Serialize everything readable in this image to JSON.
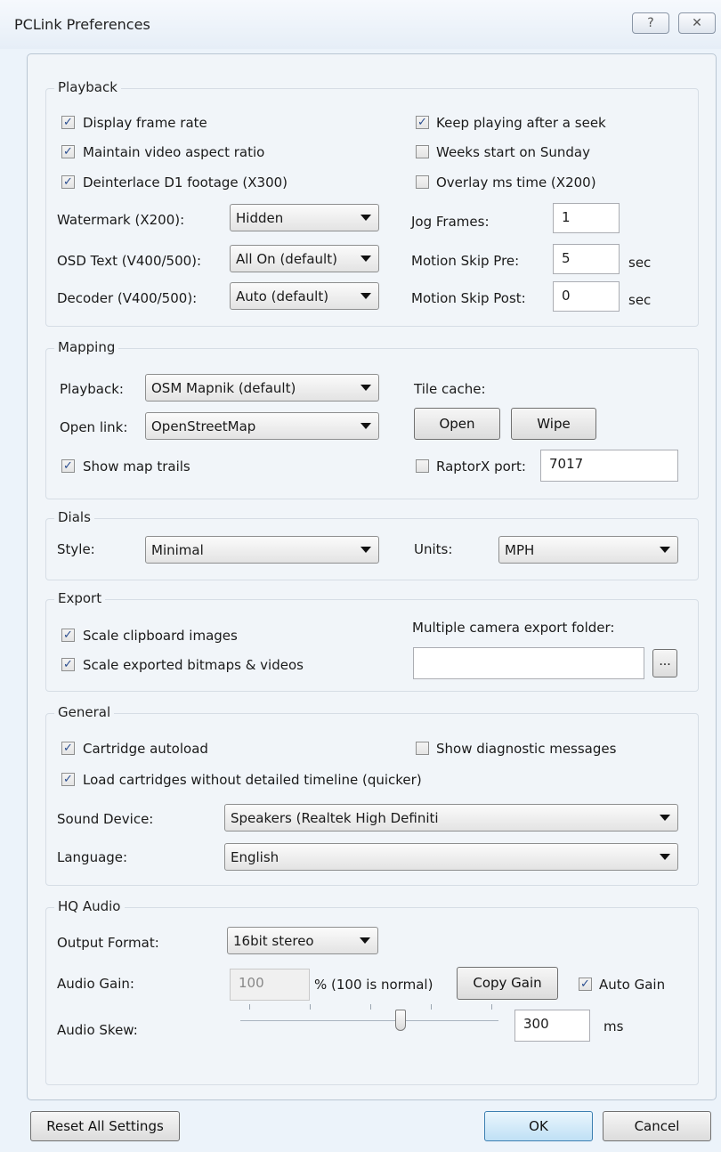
{
  "window": {
    "title": "PCLink Preferences",
    "help_label": "?",
    "close_label": "☒"
  },
  "playback": {
    "title": "Playback",
    "display_frame_rate": {
      "label": "Display frame rate",
      "checked": true
    },
    "maintain_aspect": {
      "label": "Maintain video aspect ratio",
      "checked": true
    },
    "deinterlace": {
      "label": "Deinterlace D1 footage (X300)",
      "checked": true
    },
    "keep_playing": {
      "label": "Keep playing after a seek",
      "checked": true
    },
    "weeks_sunday": {
      "label": "Weeks start on Sunday",
      "checked": false
    },
    "overlay_ms": {
      "label": "Overlay ms time (X200)",
      "checked": false
    },
    "watermark": {
      "label": "Watermark (X200):",
      "value": "Hidden"
    },
    "osd_text": {
      "label": "OSD Text (V400/500):",
      "value": "All On (default)"
    },
    "decoder": {
      "label": "Decoder (V400/500):",
      "value": "Auto (default)"
    },
    "jog_frames": {
      "label": "Jog Frames:",
      "value": "1"
    },
    "motion_skip_pre": {
      "label": "Motion Skip Pre:",
      "value": "5",
      "unit": "sec"
    },
    "motion_skip_post": {
      "label": "Motion Skip Post:",
      "value": "0",
      "unit": "sec"
    }
  },
  "mapping": {
    "title": "Mapping",
    "playback": {
      "label": "Playback:",
      "value": "OSM Mapnik (default)"
    },
    "open_link": {
      "label": "Open link:",
      "value": "OpenStreetMap"
    },
    "show_trails": {
      "label": "Show map trails",
      "checked": true
    },
    "tile_cache_label": "Tile cache:",
    "open_button": "Open",
    "wipe_button": "Wipe",
    "raptorx": {
      "label": "RaptorX port:",
      "checked": false,
      "value": "7017"
    }
  },
  "dials": {
    "title": "Dials",
    "style": {
      "label": "Style:",
      "value": "Minimal"
    },
    "units": {
      "label": "Units:",
      "value": "MPH"
    }
  },
  "export": {
    "title": "Export",
    "scale_clipboard": {
      "label": "Scale clipboard images",
      "checked": true
    },
    "scale_exported": {
      "label": "Scale exported bitmaps & videos",
      "checked": true
    },
    "folder_label": "Multiple camera export folder:",
    "folder_value": "",
    "browse_label": "..."
  },
  "general": {
    "title": "General",
    "cartridge_autoload": {
      "label": "Cartridge autoload",
      "checked": true
    },
    "show_diagnostic": {
      "label": "Show diagnostic messages",
      "checked": false
    },
    "load_cartridges": {
      "label": "Load cartridges without detailed timeline (quicker)",
      "checked": true
    },
    "sound_device": {
      "label": "Sound Device:",
      "value": "Speakers (Realtek High Definiti"
    },
    "language": {
      "label": "Language:",
      "value": "English"
    }
  },
  "hq_audio": {
    "title": "HQ Audio",
    "output_format": {
      "label": "Output Format:",
      "value": "16bit stereo"
    },
    "audio_gain": {
      "label": "Audio Gain:",
      "value": "100",
      "suffix": "% (100 is normal)"
    },
    "copy_gain_button": "Copy Gain",
    "auto_gain": {
      "label": "Auto Gain",
      "checked": true
    },
    "audio_skew": {
      "label": "Audio Skew:",
      "value": "300",
      "unit": "ms",
      "slider_fraction": 0.62
    }
  },
  "footer": {
    "reset_button": "Reset All Settings",
    "ok_button": "OK",
    "cancel_button": "Cancel"
  },
  "icons": {
    "checkmark": "✓"
  }
}
